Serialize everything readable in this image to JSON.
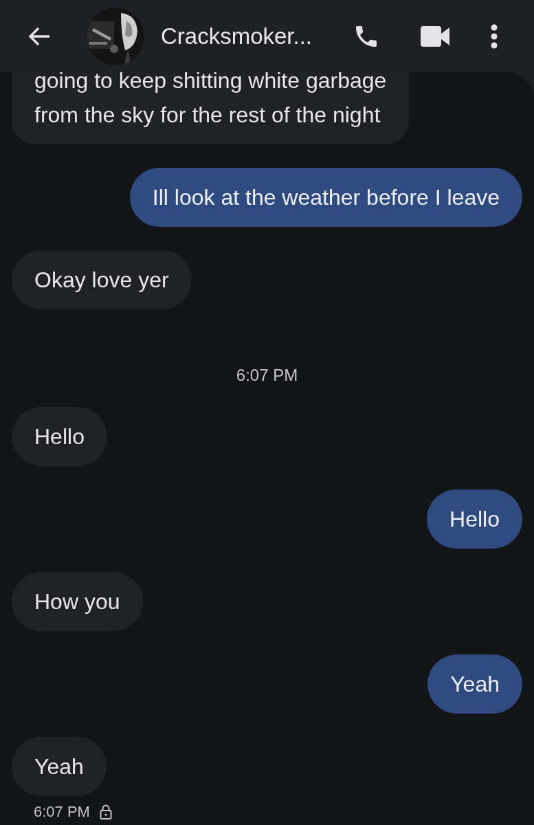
{
  "header": {
    "contact_name": "Cracksmoker..."
  },
  "messages": [
    {
      "kind": "incoming",
      "lines": [
        "going to keep shitting white garbage",
        "from the sky for the rest of the night"
      ]
    },
    {
      "kind": "outgoing",
      "lines": [
        "Ill look at the weather before I leave"
      ]
    },
    {
      "kind": "incoming",
      "lines": [
        "Okay love yer"
      ]
    },
    {
      "kind": "timestamp",
      "text": "6:07 PM"
    },
    {
      "kind": "incoming",
      "lines": [
        "Hello"
      ]
    },
    {
      "kind": "outgoing",
      "lines": [
        "Hello"
      ]
    },
    {
      "kind": "incoming",
      "lines": [
        "How you"
      ]
    },
    {
      "kind": "outgoing",
      "lines": [
        "Yeah"
      ]
    },
    {
      "kind": "incoming",
      "lines": [
        "Yeah"
      ]
    }
  ],
  "status": {
    "time": "6:07 PM",
    "encrypted": true
  }
}
